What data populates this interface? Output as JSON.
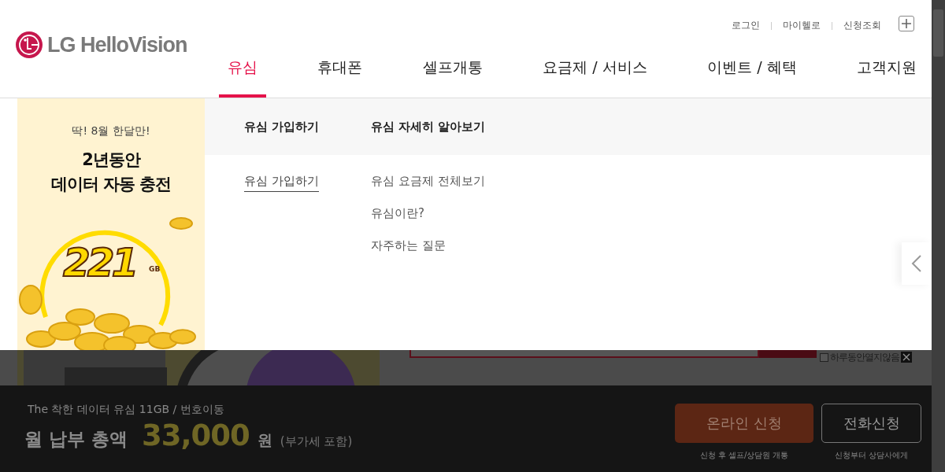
{
  "header": {
    "logo": "LG HelloVision",
    "util_links": [
      "로그인",
      "마이헬로",
      "신청조회"
    ],
    "nav": [
      {
        "label": "유심",
        "selected": true
      },
      {
        "label": "휴대폰",
        "selected": false
      },
      {
        "label": "셀프개통",
        "selected": false
      },
      {
        "label": "요금제 / 서비스",
        "selected": false
      },
      {
        "label": "이벤트 / 혜택",
        "selected": false
      },
      {
        "label": "고객지원",
        "selected": false
      }
    ]
  },
  "mega_menu": {
    "banner": {
      "kicker": "딱! 8월 한달만!",
      "headline": [
        "2년동안",
        "데이터 자동 충전"
      ],
      "figure": "221",
      "unit": "GB"
    },
    "columns": [
      {
        "title": "유심 가입하기",
        "links": [
          {
            "label": "유심 가입하기",
            "selected": true
          }
        ]
      },
      {
        "title": "유심 자세히 알아보기",
        "links": [
          {
            "label": "유심 요금제 전체보기",
            "selected": false
          },
          {
            "label": "유심이란?",
            "selected": false
          },
          {
            "label": "자주하는 질문",
            "selected": false
          }
        ]
      }
    ]
  },
  "popup": {
    "dismiss_label": "하루동안열지않음",
    "checked": false
  },
  "bottom_bar": {
    "product": "The 착한 데이터 유심 11GB / 번호이동",
    "total_label": "월 납부 총액",
    "amount": "33,000",
    "currency": "원",
    "vat_note": "(부가세 포함)",
    "buttons": [
      {
        "label": "온라인 신청",
        "caption": "신청 후 셀프/상담원 개통",
        "kind": "primary"
      },
      {
        "label": "전화신청",
        "caption": "신청부터 상담사에게",
        "kind": "secondary"
      }
    ]
  }
}
